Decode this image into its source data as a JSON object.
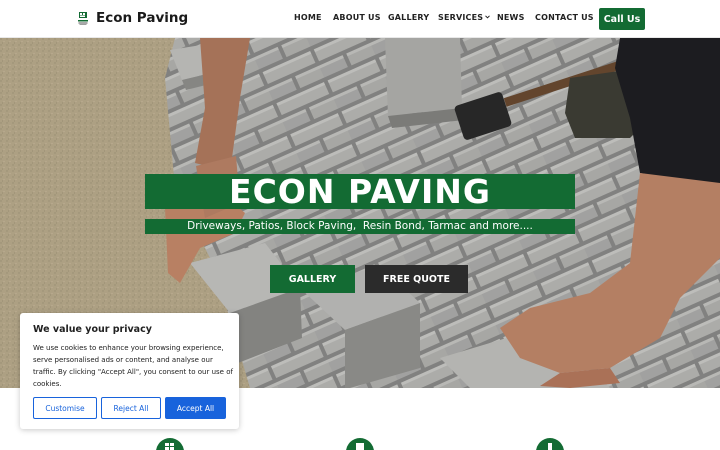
{
  "header": {
    "brand": "Econ Paving",
    "nav": {
      "home": "HOME",
      "about": "ABOUT US",
      "gallery": "GALLERY",
      "services": "SERVICES",
      "news": "NEWS",
      "contact": "CONTACT US"
    },
    "call_label": "Call Us"
  },
  "hero": {
    "title": "ECON PAVING",
    "subtitle": "Driveways, Patios, Block Paving,  Resin Bond, Tarmac and more....",
    "gallery_button": "GALLERY",
    "quote_button": "FREE QUOTE"
  },
  "cookie_banner": {
    "title": "We value your privacy",
    "text": "We use cookies to enhance your browsing experience, serve personalised ads or content, and analyse our traffic. By clicking \"Accept All\", you consent to our use of cookies.",
    "customise": "Customise",
    "reject": "Reject All",
    "accept": "Accept All"
  },
  "colors": {
    "brand_green": "#136b33",
    "dark_button": "#2b2b2b",
    "cookie_blue": "#1863dc"
  },
  "icons": [
    "logo-icon",
    "chevron-down-icon",
    "feature-icon"
  ]
}
